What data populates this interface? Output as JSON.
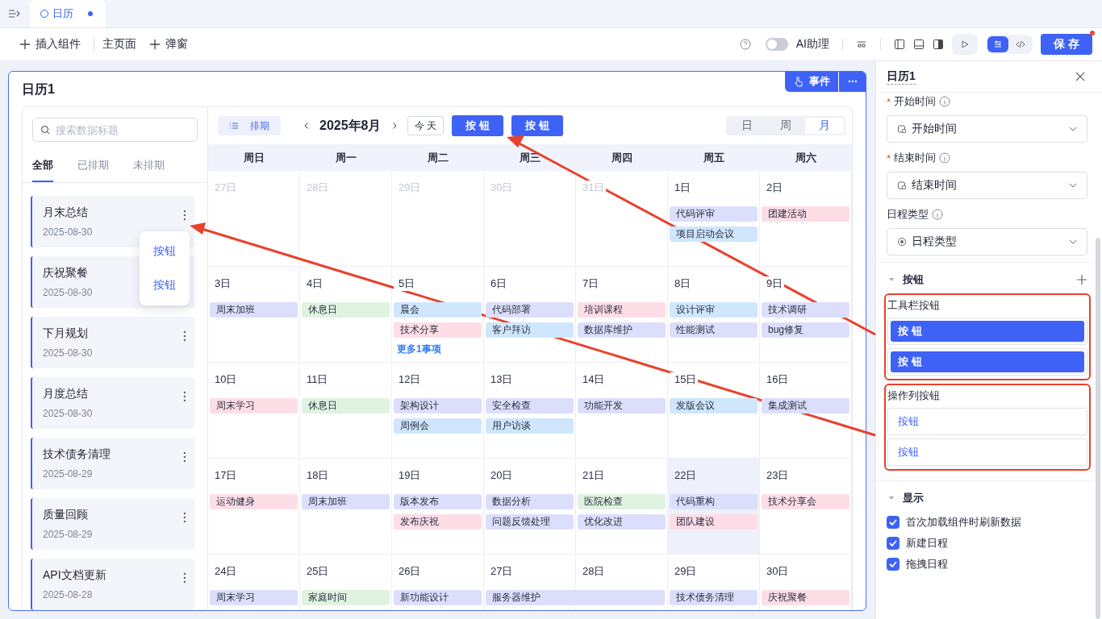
{
  "tabs": [
    {
      "label": "日历",
      "selected": true,
      "unsaved": true
    }
  ],
  "toolbar": {
    "items": [
      {
        "label": "插入组件",
        "kind": "add"
      },
      {
        "label": "主页面",
        "kind": "page"
      },
      {
        "label": "弹窗",
        "kind": "add"
      }
    ],
    "ai_toggle": {
      "label": "AI助理",
      "on": false
    },
    "modes": [
      {
        "kind": "settings",
        "selected": true
      },
      {
        "kind": "code",
        "selected": false
      }
    ],
    "save_button": "保 存",
    "save_dot": true
  },
  "canvas": {
    "title": "日历1",
    "event_button": "事件"
  },
  "sidebar": {
    "search_placeholder": "搜索数据标题",
    "filters": [
      {
        "label": "全部",
        "selected": true
      },
      {
        "label": "已排期",
        "selected": false
      },
      {
        "label": "未排期",
        "selected": false
      }
    ],
    "items": [
      {
        "title": "月末总结",
        "date": "2025-08-30"
      },
      {
        "title": "庆祝聚餐",
        "date": "2025-08-30"
      },
      {
        "title": "下月规划",
        "date": "2025-08-30"
      },
      {
        "title": "月度总结",
        "date": "2025-08-30"
      },
      {
        "title": "技术债务清理",
        "date": "2025-08-29"
      },
      {
        "title": "质量回顾",
        "date": "2025-08-29"
      },
      {
        "title": "API文档更新",
        "date": "2025-08-28"
      }
    ],
    "menu": [
      "按钮",
      "按钮"
    ]
  },
  "calendar": {
    "schedule_button": "排期",
    "month": "2025年8月",
    "today_button": "今 天",
    "buttons": [
      "按 钮",
      "按 钮"
    ],
    "views": [
      {
        "label": "日",
        "selected": false
      },
      {
        "label": "周",
        "selected": false
      },
      {
        "label": "月",
        "selected": true
      }
    ],
    "weekdays": [
      "周日",
      "周一",
      "周二",
      "周三",
      "周四",
      "周五",
      "周六"
    ],
    "weeks": [
      [
        {
          "label": "27日",
          "muted": true,
          "today": false
        },
        {
          "label": "28日",
          "muted": true,
          "today": false
        },
        {
          "label": "29日",
          "muted": true,
          "today": false
        },
        {
          "label": "30日",
          "muted": true,
          "today": false
        },
        {
          "label": "31日",
          "muted": true,
          "today": false
        },
        {
          "label": "1日",
          "muted": false,
          "today": false,
          "events": [
            {
              "title": "代码评审",
              "color": "#dcdffb"
            },
            {
              "title": "项目启动会议",
              "color": "#cfe6fd"
            }
          ]
        },
        {
          "label": "2日",
          "muted": false,
          "today": false,
          "events": [
            {
              "title": "团建活动",
              "color": "#fddde6"
            }
          ]
        }
      ],
      [
        {
          "label": "3日",
          "muted": false,
          "today": false,
          "events": [
            {
              "title": "周末加班",
              "color": "#dcdffb"
            }
          ]
        },
        {
          "label": "4日",
          "muted": false,
          "today": false,
          "events": [
            {
              "title": "休息日",
              "color": "#dff3e1"
            }
          ]
        },
        {
          "label": "5日",
          "muted": false,
          "today": false,
          "events": [
            {
              "title": "晨会",
              "color": "#cfe6fd"
            },
            {
              "title": "技术分享",
              "color": "#fddde6"
            }
          ],
          "more": "更多1事项"
        },
        {
          "label": "6日",
          "muted": false,
          "today": false,
          "events": [
            {
              "title": "代码部署",
              "color": "#dcdffb"
            },
            {
              "title": "客户拜访",
              "color": "#cfe6fd"
            }
          ]
        },
        {
          "label": "7日",
          "muted": false,
          "today": false,
          "events": [
            {
              "title": "培训课程",
              "color": "#fddde6"
            },
            {
              "title": "数据库维护",
              "color": "#dcdffb"
            }
          ]
        },
        {
          "label": "8日",
          "muted": false,
          "today": false,
          "events": [
            {
              "title": "设计评审",
              "color": "#cfe6fd"
            },
            {
              "title": "性能测试",
              "color": "#dcdffb"
            }
          ]
        },
        {
          "label": "9日",
          "muted": false,
          "today": false,
          "events": [
            {
              "title": "技术调研",
              "color": "#dcdffb"
            },
            {
              "title": "bug修复",
              "color": "#dcdffb"
            }
          ]
        }
      ],
      [
        {
          "label": "10日",
          "muted": false,
          "today": false,
          "events": [
            {
              "title": "周末学习",
              "color": "#fddde6"
            }
          ]
        },
        {
          "label": "11日",
          "muted": false,
          "today": false,
          "events": [
            {
              "title": "休息日",
              "color": "#dff3e1"
            }
          ]
        },
        {
          "label": "12日",
          "muted": false,
          "today": false,
          "events": [
            {
              "title": "架构设计",
              "color": "#dcdffb"
            },
            {
              "title": "周例会",
              "color": "#cfe6fd"
            }
          ]
        },
        {
          "label": "13日",
          "muted": false,
          "today": false,
          "events": [
            {
              "title": "安全检查",
              "color": "#dcdffb"
            },
            {
              "title": "用户访谈",
              "color": "#cfe6fd"
            }
          ]
        },
        {
          "label": "14日",
          "muted": false,
          "today": false,
          "events": [
            {
              "title": "功能开发",
              "color": "#dcdffb"
            }
          ]
        },
        {
          "label": "15日",
          "muted": false,
          "today": false,
          "events": [
            {
              "title": "发版会议",
              "color": "#cfe6fd"
            }
          ]
        },
        {
          "label": "16日",
          "muted": false,
          "today": false,
          "events": [
            {
              "title": "集成测试",
              "color": "#dcdffb"
            }
          ]
        }
      ],
      [
        {
          "label": "17日",
          "muted": false,
          "today": false,
          "events": [
            {
              "title": "运动健身",
              "color": "#fddde6"
            }
          ]
        },
        {
          "label": "18日",
          "muted": false,
          "today": false,
          "events": [
            {
              "title": "周末加班",
              "color": "#dcdffb"
            }
          ]
        },
        {
          "label": "19日",
          "muted": false,
          "today": false,
          "events": [
            {
              "title": "版本发布",
              "color": "#dcdffb"
            },
            {
              "title": "发布庆祝",
              "color": "#fddde6"
            }
          ]
        },
        {
          "label": "20日",
          "muted": false,
          "today": false,
          "events": [
            {
              "title": "数据分析",
              "color": "#dcdffb"
            },
            {
              "title": "问题反馈处理",
              "color": "#dcdffb"
            }
          ]
        },
        {
          "label": "21日",
          "muted": false,
          "today": false,
          "events": [
            {
              "title": "医院检查",
              "color": "#dff3e1"
            },
            {
              "title": "优化改进",
              "color": "#dcdffb"
            }
          ]
        },
        {
          "label": "22日",
          "muted": false,
          "today": true,
          "events": [
            {
              "title": "代码重构",
              "color": "#dcdffb"
            },
            {
              "title": "团队建设",
              "color": "#fddde6"
            }
          ]
        },
        {
          "label": "23日",
          "muted": false,
          "today": false,
          "events": [
            {
              "title": "技术分享会",
              "color": "#fddde6"
            }
          ]
        }
      ],
      [
        {
          "label": "24日",
          "muted": false,
          "today": false,
          "events": [
            {
              "title": "周末学习",
              "color": "#dcdffb"
            }
          ]
        },
        {
          "label": "25日",
          "muted": false,
          "today": false,
          "events": [
            {
              "title": "家庭时间",
              "color": "#dff3e1"
            }
          ]
        },
        {
          "label": "26日",
          "muted": false,
          "today": false,
          "events": [
            {
              "title": "新功能设计",
              "color": "#dcdffb"
            }
          ]
        },
        {
          "label": "27日",
          "muted": false,
          "today": false,
          "events": [
            {
              "title": "服务器维护",
              "color": "#dcdffb",
              "kind": "multi-day"
            }
          ]
        },
        {
          "label": "28日",
          "muted": false,
          "today": false
        },
        {
          "label": "29日",
          "muted": false,
          "today": false,
          "events": [
            {
              "title": "技术债务清理",
              "color": "#dcdffb"
            }
          ]
        },
        {
          "label": "30日",
          "muted": false,
          "today": false,
          "events": [
            {
              "title": "庆祝聚餐",
              "color": "#fddde6"
            }
          ]
        }
      ]
    ]
  },
  "panel": {
    "title": "日历1",
    "required_mark": "*",
    "fields": [
      {
        "label": "开始时间",
        "required": true,
        "value": "开始时间",
        "kind": "date"
      },
      {
        "label": "结束时间",
        "required": true,
        "value": "结束时间",
        "kind": "date"
      },
      {
        "label": "日程类型",
        "required": false,
        "value": "日程类型",
        "kind": "option"
      }
    ],
    "buttons_section": {
      "title": "按钮",
      "toolbar_label": "工具栏按钮",
      "toolbar_buttons": [
        "按 钮",
        "按 钮"
      ],
      "row_label": "操作列按钮",
      "row_buttons": [
        "按钮",
        "按钮"
      ]
    },
    "display_section": {
      "title": "显示",
      "options": [
        {
          "label": "首次加载组件时刷新数据",
          "checked": true
        },
        {
          "label": "新建日程",
          "checked": true
        },
        {
          "label": "拖拽日程",
          "checked": true
        }
      ]
    }
  }
}
